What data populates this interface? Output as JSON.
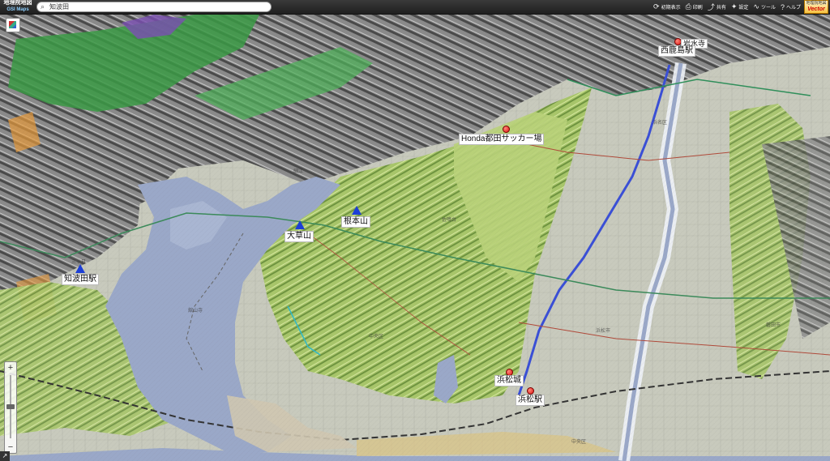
{
  "app": {
    "logo_line1": "地理院地図",
    "logo_line2": "GSI Maps",
    "search_value": "知波田",
    "vector_line1": "地理院地図",
    "vector_line2": "Vector"
  },
  "toolbar": {
    "items": [
      {
        "label": "初期表示",
        "icon": "refresh-icon",
        "glyph": "⟳"
      },
      {
        "label": "印刷",
        "icon": "print-icon",
        "glyph": "⎙"
      },
      {
        "label": "共有",
        "icon": "share-icon",
        "glyph": "⤴"
      },
      {
        "label": "設定",
        "icon": "gear-icon",
        "glyph": "✦"
      },
      {
        "label": "ツール",
        "icon": "chart-icon",
        "glyph": "📈"
      },
      {
        "label": "ヘルプ",
        "icon": "help-icon",
        "glyph": "?"
      }
    ]
  },
  "map": {
    "labels": {
      "honda": "Honda都田サッカー場",
      "nishikajima": "西鹿島駅",
      "nishikajima_top": "岩水寺",
      "nekoyama": "根本山",
      "ogusayama": "大草山",
      "chibata": "知波田駅",
      "hamamatsujo": "浜松城",
      "hamamatsueki": "浜松駅"
    },
    "small_labels": {
      "hamana": "浜名区",
      "chuo": "中央区",
      "chuo2": "中央区",
      "hamamatsushi": "浜松市",
      "iwata": "磐田市",
      "mikkabi": "三ヶ日",
      "hosoe": "細江",
      "sanarudai": "佐鳴台",
      "kannzanji": "舘山寺"
    },
    "colors": {
      "lake": "#9aa8c8",
      "mountain": "#7a7a7a",
      "plateau": "#b9d27a",
      "lowland": "#c9c9bf",
      "forest": "#2f8f3a",
      "railway_blue": "#3a4fd6"
    }
  }
}
